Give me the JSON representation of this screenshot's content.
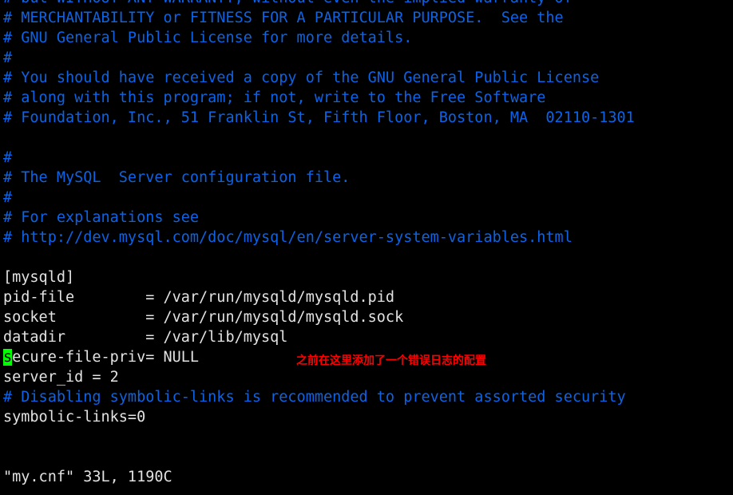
{
  "terminal": {
    "app": "vim",
    "background_color": "#000000",
    "comment_color": "#0b63e5",
    "text_color": "#e2e2e2",
    "cursor_color": "#00ff00",
    "annotation_color": "#ff0000"
  },
  "editor": {
    "lines": [
      "# but WITHOUT ANY WARRANTY; without even the implied warranty of",
      "# MERCHANTABILITY or FITNESS FOR A PARTICULAR PURPOSE.  See the",
      "# GNU General Public License for more details.",
      "#",
      "# You should have received a copy of the GNU General Public License",
      "# along with this program; if not, write to the Free Software",
      "# Foundation, Inc., 51 Franklin St, Fifth Floor, Boston, MA  02110-1301",
      "",
      "#",
      "# The MySQL  Server configuration file.",
      "#",
      "# For explanations see",
      "# http://dev.mysql.com/doc/mysql/en/server-system-variables.html",
      "",
      "[mysqld]",
      "pid-file        = /var/run/mysqld/mysqld.pid",
      "socket          = /var/run/mysqld/mysqld.sock",
      "datadir         = /var/lib/mysql",
      "",
      "server_id = 2",
      "# Disabling symbolic-links is recommended to prevent assorted security",
      "symbolic-links=0",
      "",
      ""
    ],
    "cursor_line": {
      "cursor_char": "s",
      "rest": "ecure-file-priv= NULL"
    }
  },
  "annotation": {
    "text": "之前在这里添加了一个错误日志的配置"
  },
  "status": {
    "text": "\"my.cnf\" 33L, 1190C"
  }
}
